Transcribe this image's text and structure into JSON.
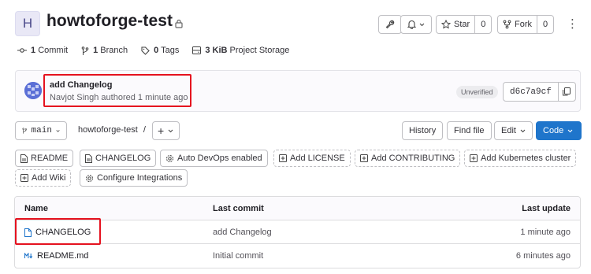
{
  "project": {
    "avatar_letter": "H",
    "name": "howtoforge-test"
  },
  "header_actions": {
    "star_label": "Star",
    "star_count": "0",
    "fork_label": "Fork",
    "fork_count": "0"
  },
  "stats": {
    "commits_count": "1",
    "commits_label": "Commit",
    "branches_count": "1",
    "branches_label": "Branch",
    "tags_count": "0",
    "tags_label": "Tags",
    "storage_size": "3 KiB",
    "storage_label": "Project Storage"
  },
  "last_commit": {
    "title": "add Changelog",
    "meta": "Navjot Singh authored 1 minute ago",
    "badge": "Unverified",
    "sha": "d6c7a9cf"
  },
  "toolbar": {
    "branch": "main",
    "path": "howtoforge-test",
    "path_sep": "/",
    "add_label": "+",
    "history_label": "History",
    "find_file_label": "Find file",
    "edit_label": "Edit",
    "code_label": "Code"
  },
  "quick_links": {
    "readme": "README",
    "changelog": "CHANGELOG",
    "auto_devops": "Auto DevOps enabled",
    "add_license": "Add LICENSE",
    "add_contributing": "Add CONTRIBUTING",
    "add_k8s": "Add Kubernetes cluster",
    "add_wiki": "Add Wiki",
    "configure_integrations": "Configure Integrations"
  },
  "file_table": {
    "headers": {
      "name": "Name",
      "last_commit": "Last commit",
      "last_update": "Last update"
    },
    "rows": [
      {
        "name": "CHANGELOG",
        "commit": "add Changelog",
        "updated": "1 minute ago",
        "icon": "file-icon"
      },
      {
        "name": "README.md",
        "commit": "Initial commit",
        "updated": "6 minutes ago",
        "icon": "markdown-icon"
      }
    ]
  },
  "colors": {
    "primary": "#1f75cb",
    "highlight": "#e5121f"
  }
}
